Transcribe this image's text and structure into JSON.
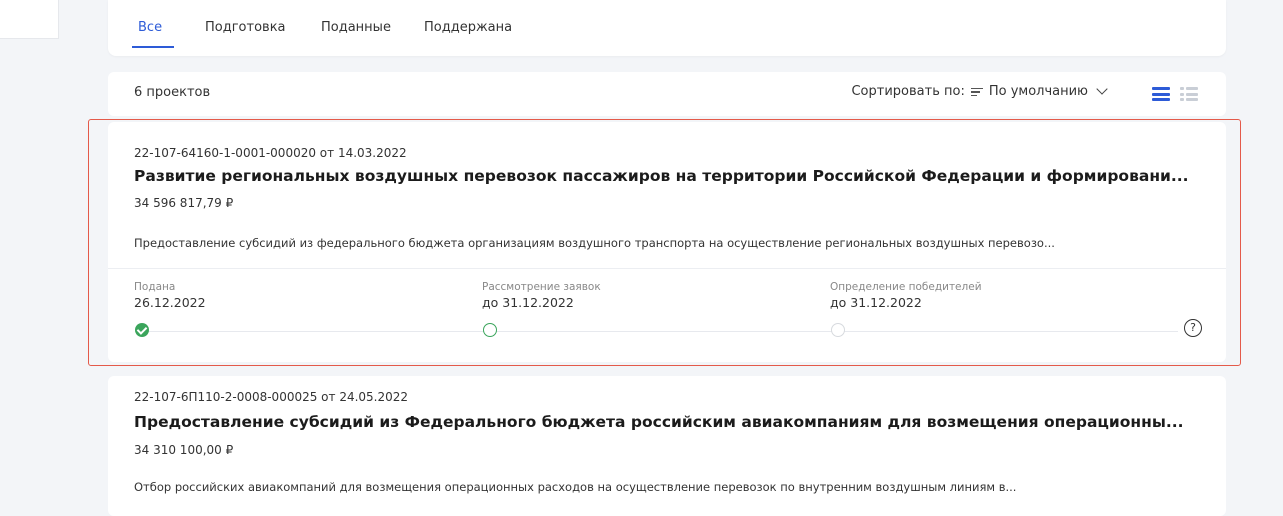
{
  "tabs": [
    {
      "label": "Все",
      "active": true
    },
    {
      "label": "Подготовка",
      "active": false
    },
    {
      "label": "Поданные",
      "active": false
    },
    {
      "label": "Поддержана",
      "active": false
    }
  ],
  "toolbar": {
    "count_label": "6 проектов",
    "sort_prefix": "Сортировать по:",
    "sort_value": "По умолчанию",
    "view_modes": [
      "list-view-icon",
      "grid-view-icon"
    ],
    "active_view": "list"
  },
  "projects": [
    {
      "reg_number": "22-107-64160-1-0001-000020 от 14.03.2022",
      "title": "Развитие региональных воздушных перевозок пассажиров на территории Российской Федерации и формировани...",
      "amount": "34 596 817,79 ₽",
      "description": "Предоставление субсидий из федерального бюджета организациям воздушного транспорта на осуществление региональных воздушных перевозо...",
      "stages": [
        {
          "label": "Подана",
          "date": "26.12.2022",
          "status": "done"
        },
        {
          "label": "Рассмотрение заявок",
          "date": "до 31.12.2022",
          "status": "current"
        },
        {
          "label": "Определение победителей",
          "date": "до 31.12.2022",
          "status": "pending"
        }
      ],
      "help_icon": "?"
    },
    {
      "reg_number": "22-107-6П110-2-0008-000025 от 24.05.2022",
      "title": "Предоставление субсидий из Федерального бюджета российским авиакомпаниям для возмещения операционны...",
      "amount": "34 310 100,00 ₽",
      "description": "Отбор российских авиакомпаний для возмещения операционных расходов на осуществление перевозок по внутренним воздушным линиям в..."
    }
  ],
  "colors": {
    "accent": "#2d5bd7",
    "success": "#3ba55c",
    "highlight": "#e45a4a",
    "background": "#f3f5f8"
  }
}
